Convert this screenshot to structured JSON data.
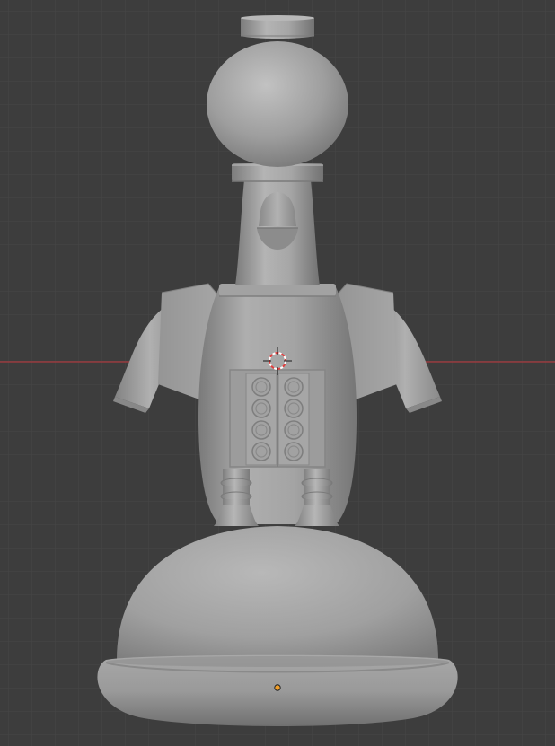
{
  "app": {
    "viewport": "3d-viewport",
    "view": "front-orthographic",
    "overlays": {
      "grid": true,
      "x_axis_line": true,
      "cursor_3d": true,
      "origin_point": true
    }
  },
  "scene": {
    "object": "robot-mesh",
    "shading": "solid"
  },
  "colors": {
    "background": "#3d3d3d",
    "grid_minor": "#454545",
    "grid_major": "#4a4a4a",
    "x_axis": "#a83a3e",
    "mesh_base": "#9a9a9a",
    "origin": "#f2a02b",
    "cursor_red": "#e04040",
    "cursor_white": "#ffffff"
  },
  "icons": {
    "cursor": "3d-cursor-icon",
    "origin": "object-origin-icon"
  }
}
